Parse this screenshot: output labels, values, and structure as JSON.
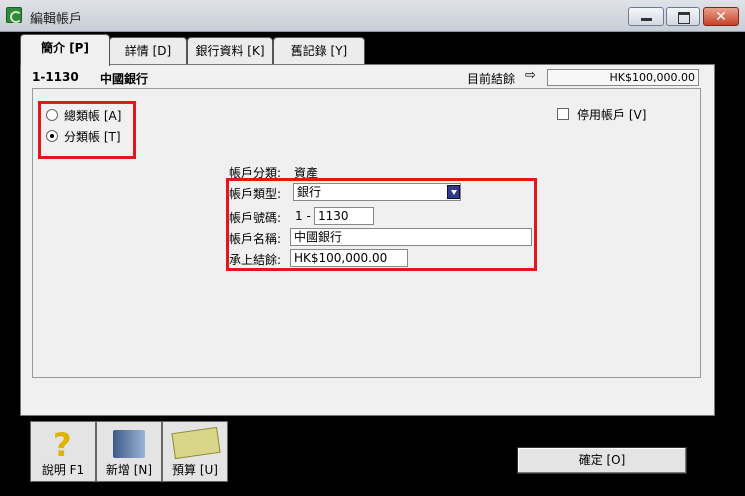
{
  "window": {
    "title": "編輯帳戶"
  },
  "tabs": [
    {
      "label": "簡介 [P]"
    },
    {
      "label": "詳情 [D]"
    },
    {
      "label": "銀行資料 [K]"
    },
    {
      "label": "舊記錄 [Y]"
    }
  ],
  "header": {
    "account_id": "1-1130",
    "account_name": "中國銀行",
    "balance_label": "目前結餘",
    "balance_value": "HK$100,000.00"
  },
  "account_level": {
    "header_label": "總類帳 [A]",
    "detail_label": "分類帳 [T]",
    "selected": "detail"
  },
  "inactive": {
    "label": "停用帳戶 [V]",
    "checked": false
  },
  "form": {
    "class_label": "帳戶分類:",
    "class_value": "資產",
    "type_label": "帳戶類型:",
    "type_value": "銀行",
    "number_label": "帳戶號碼:",
    "number_prefix": "1 -",
    "number_value": "1130",
    "name_label": "帳戶名稱:",
    "name_value": "中國銀行",
    "opening_label": "承上結餘:",
    "opening_value": "HK$100,000.00"
  },
  "toolbar": {
    "help_label": "說明 F1",
    "new_label": "新增 [N]",
    "budget_label": "預算 [U]"
  },
  "ok_label": "確定 [O]",
  "icons": {
    "app": "app-icon",
    "help": "help-icon",
    "new": "new-icon",
    "budget": "budget-icon",
    "arrow": "arrow-icon"
  },
  "colors": {
    "highlight_box": "#e01818",
    "dropdown_button": "#2e3a8c"
  }
}
